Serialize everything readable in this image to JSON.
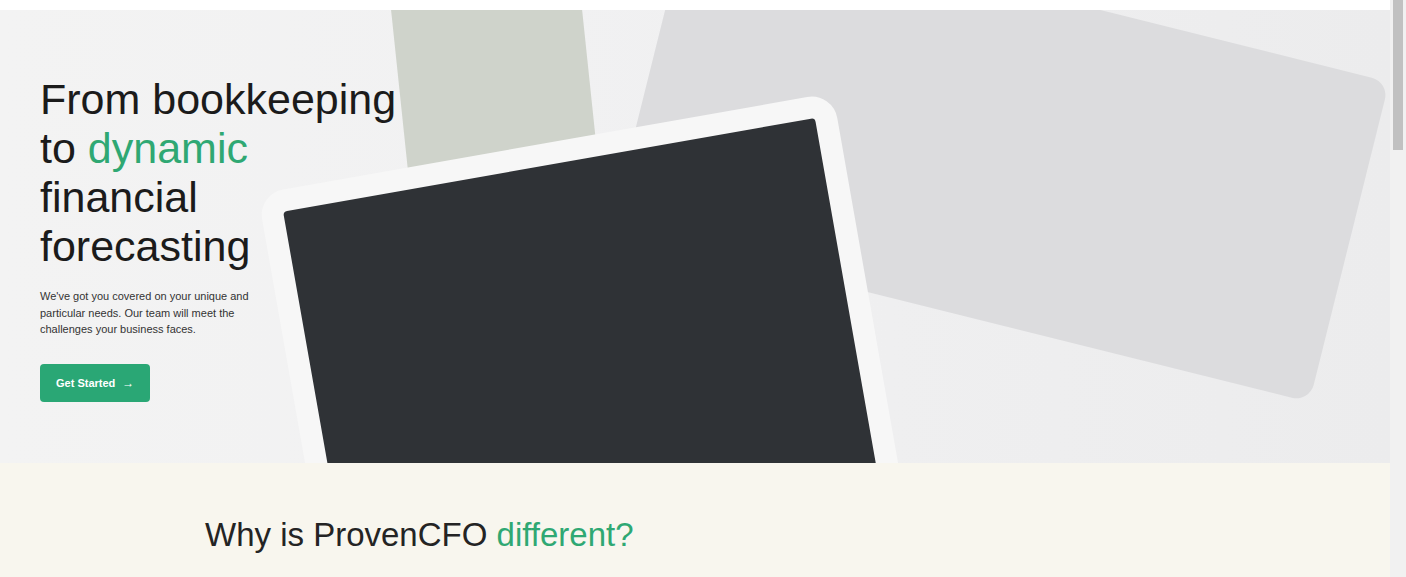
{
  "hero": {
    "title_lines": [
      [
        {
          "text": "From bookkeeping",
          "highlight": false
        }
      ],
      [
        {
          "text": "to ",
          "highlight": false
        },
        {
          "text": "dynamic",
          "highlight": true
        }
      ],
      [
        {
          "text": "financial",
          "highlight": false
        }
      ],
      [
        {
          "text": "forecasting",
          "highlight": false
        }
      ]
    ],
    "description_lines": [
      "We've got you covered on your unique and",
      "particular needs. Our team will meet the",
      "challenges your business faces."
    ],
    "button": {
      "label": "Get Started",
      "icon": "→"
    }
  },
  "section": {
    "heading": [
      {
        "text": "Why is ProvenCFO ",
        "highlight": false
      },
      {
        "text": "different?",
        "highlight": true
      }
    ]
  },
  "scrollbar": {
    "level": 0.26
  }
}
